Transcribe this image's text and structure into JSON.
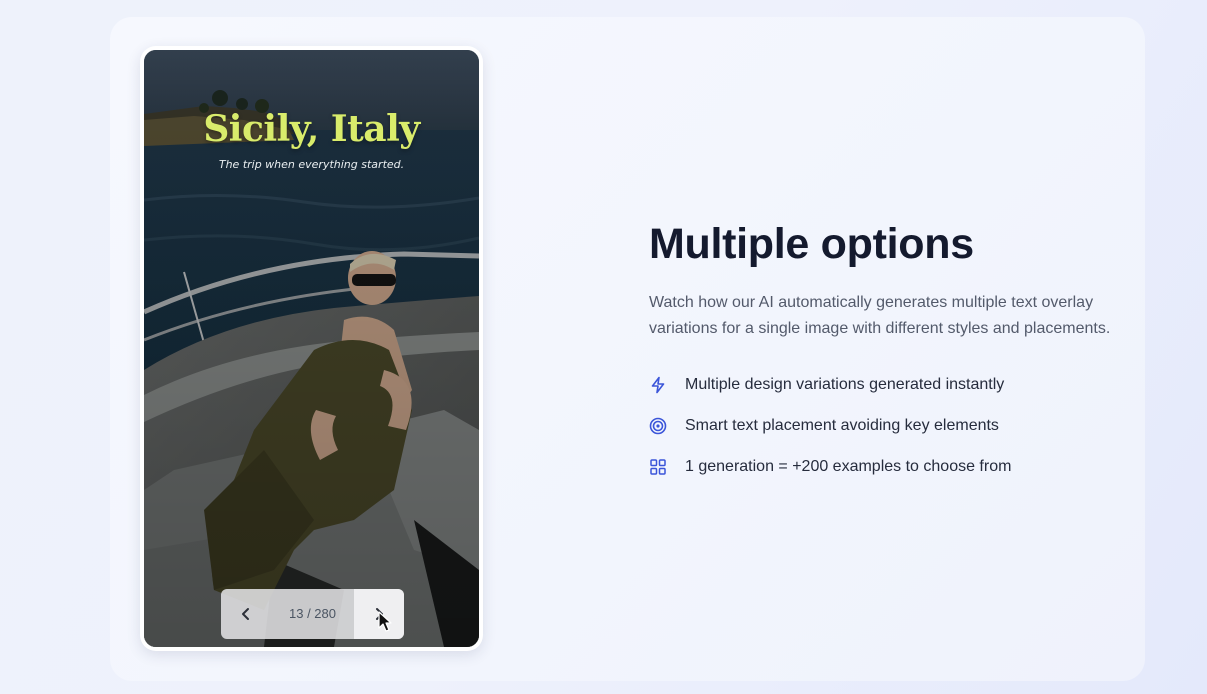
{
  "preview": {
    "title": "Sicily, Italy",
    "subtitle": "The trip when everything started.",
    "pager": {
      "current": "13",
      "total": "280",
      "label": "13 / 280",
      "prev_icon": "chevron-left-icon",
      "next_icon": "chevron-right-icon"
    },
    "title_color": "#d9ec6b"
  },
  "section": {
    "heading": "Multiple options",
    "description": "Watch how our AI automatically generates multiple text overlay variations for a single image with different styles and placements.",
    "features": [
      {
        "icon": "lightning-icon",
        "label": "Multiple design variations generated instantly"
      },
      {
        "icon": "target-icon",
        "label": "Smart text placement avoiding key elements"
      },
      {
        "icon": "grid-icon",
        "label": "1 generation = +200 examples to choose from"
      }
    ],
    "accent_color": "#3b55d9"
  }
}
